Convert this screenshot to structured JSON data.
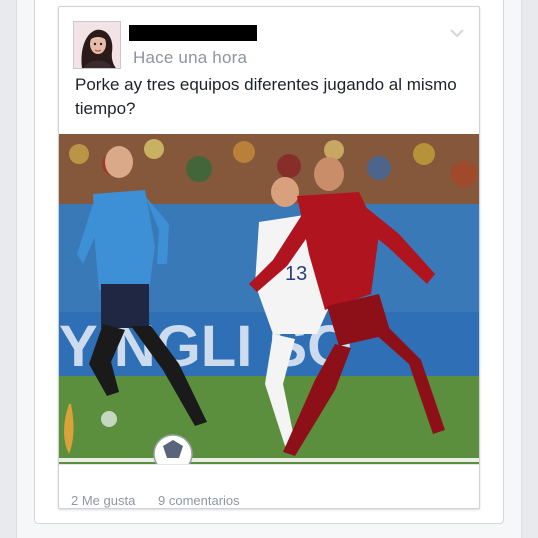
{
  "post": {
    "timestamp": "Hace una hora",
    "text": "Porke ay tres equipos diferentes jugando al mismo tiempo?",
    "photo_overlay_text": "YINGLI SO",
    "jersey_number": "13",
    "footer": {
      "likes": "2 Me gusta",
      "comments": "9 comentarios"
    }
  },
  "colors": {
    "referee_kit": "#3d8fd6",
    "usa_kit": "#f4f4f4",
    "portugal_kit": "#b0141f",
    "pitch": "#5b8f3e",
    "banner": "#2f6fb5"
  },
  "icons": {
    "menu": "chevron-down-icon"
  }
}
